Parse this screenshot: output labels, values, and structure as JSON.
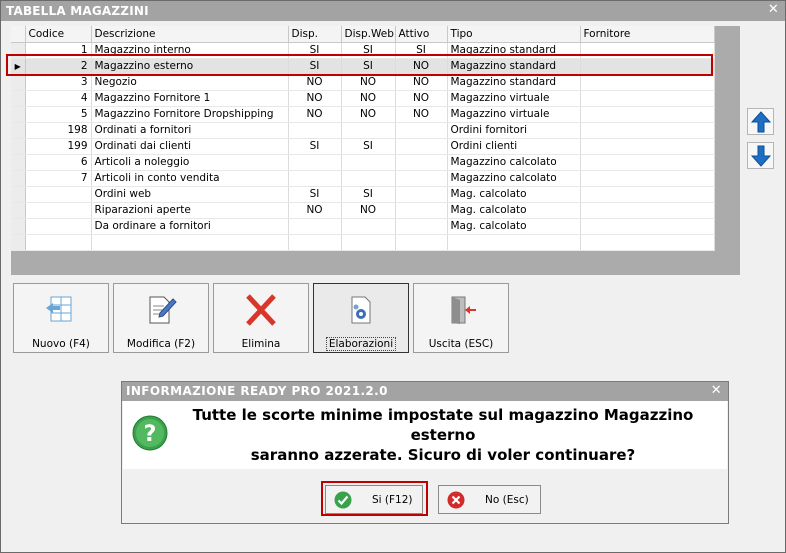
{
  "window": {
    "title": "TABELLA MAGAZZINI",
    "close_label": "✕"
  },
  "grid": {
    "columns": [
      "Codice",
      "Descrizione",
      "Disp.",
      "Disp.Web",
      "Attivo",
      "Tipo",
      "Fornitore"
    ],
    "rows": [
      {
        "codice": "1",
        "descrizione": "Magazzino interno",
        "disp": "SI",
        "disp_web": "SI",
        "attivo": "SI",
        "tipo": "Magazzino standard",
        "fornitore": ""
      },
      {
        "codice": "2",
        "descrizione": "Magazzino esterno",
        "disp": "SI",
        "disp_web": "SI",
        "attivo": "NO",
        "tipo": "Magazzino standard",
        "fornitore": ""
      },
      {
        "codice": "3",
        "descrizione": "Negozio",
        "disp": "NO",
        "disp_web": "NO",
        "attivo": "NO",
        "tipo": "Magazzino standard",
        "fornitore": ""
      },
      {
        "codice": "4",
        "descrizione": "Magazzino Fornitore 1",
        "disp": "NO",
        "disp_web": "NO",
        "attivo": "NO",
        "tipo": "Magazzino virtuale",
        "fornitore": ""
      },
      {
        "codice": "5",
        "descrizione": "Magazzino Fornitore Dropshipping",
        "disp": "NO",
        "disp_web": "NO",
        "attivo": "NO",
        "tipo": "Magazzino virtuale",
        "fornitore": ""
      },
      {
        "codice": "198",
        "descrizione": "Ordinati a fornitori",
        "disp": "",
        "disp_web": "",
        "attivo": "",
        "tipo": "Ordini fornitori",
        "fornitore": ""
      },
      {
        "codice": "199",
        "descrizione": "Ordinati dai clienti",
        "disp": "SI",
        "disp_web": "SI",
        "attivo": "",
        "tipo": "Ordini clienti",
        "fornitore": ""
      },
      {
        "codice": "6",
        "descrizione": "Articoli a noleggio",
        "disp": "",
        "disp_web": "",
        "attivo": "",
        "tipo": "Magazzino calcolato",
        "fornitore": ""
      },
      {
        "codice": "7",
        "descrizione": "Articoli in conto vendita",
        "disp": "",
        "disp_web": "",
        "attivo": "",
        "tipo": "Magazzino calcolato",
        "fornitore": ""
      },
      {
        "codice": "",
        "descrizione": "Ordini web",
        "disp": "SI",
        "disp_web": "SI",
        "attivo": "",
        "tipo": "Mag. calcolato",
        "fornitore": ""
      },
      {
        "codice": "",
        "descrizione": "Riparazioni aperte",
        "disp": "NO",
        "disp_web": "NO",
        "attivo": "",
        "tipo": "Mag. calcolato",
        "fornitore": ""
      },
      {
        "codice": "",
        "descrizione": "Da ordinare a fornitori",
        "disp": "",
        "disp_web": "",
        "attivo": "",
        "tipo": "Mag. calcolato",
        "fornitore": ""
      },
      {
        "codice": "",
        "descrizione": "",
        "disp": "",
        "disp_web": "",
        "attivo": "",
        "tipo": "",
        "fornitore": ""
      }
    ],
    "selected_indicator": "▶"
  },
  "toolbar": {
    "nuovo": "Nuovo (F4)",
    "modifica": "Modifica (F2)",
    "elimina": "Elimina",
    "elaborazioni": "Elaborazioni",
    "uscita": "Uscita (ESC)"
  },
  "dialog": {
    "title": "INFORMAZIONE READY PRO 2021.2.0",
    "close_label": "✕",
    "message_line1": "Tutte le scorte minime impostate sul magazzino Magazzino esterno",
    "message_line2": "saranno azzerate. Sicuro di voler continuare?",
    "yes_label": "Si (F12)",
    "no_label": "No (Esc)"
  },
  "colors": {
    "titlebar": "#a3a3a3",
    "highlight_outline": "#c00000",
    "arrow_blue": "#1e6fc3",
    "yes_green": "#3aa24a",
    "no_red": "#d12b2b"
  }
}
